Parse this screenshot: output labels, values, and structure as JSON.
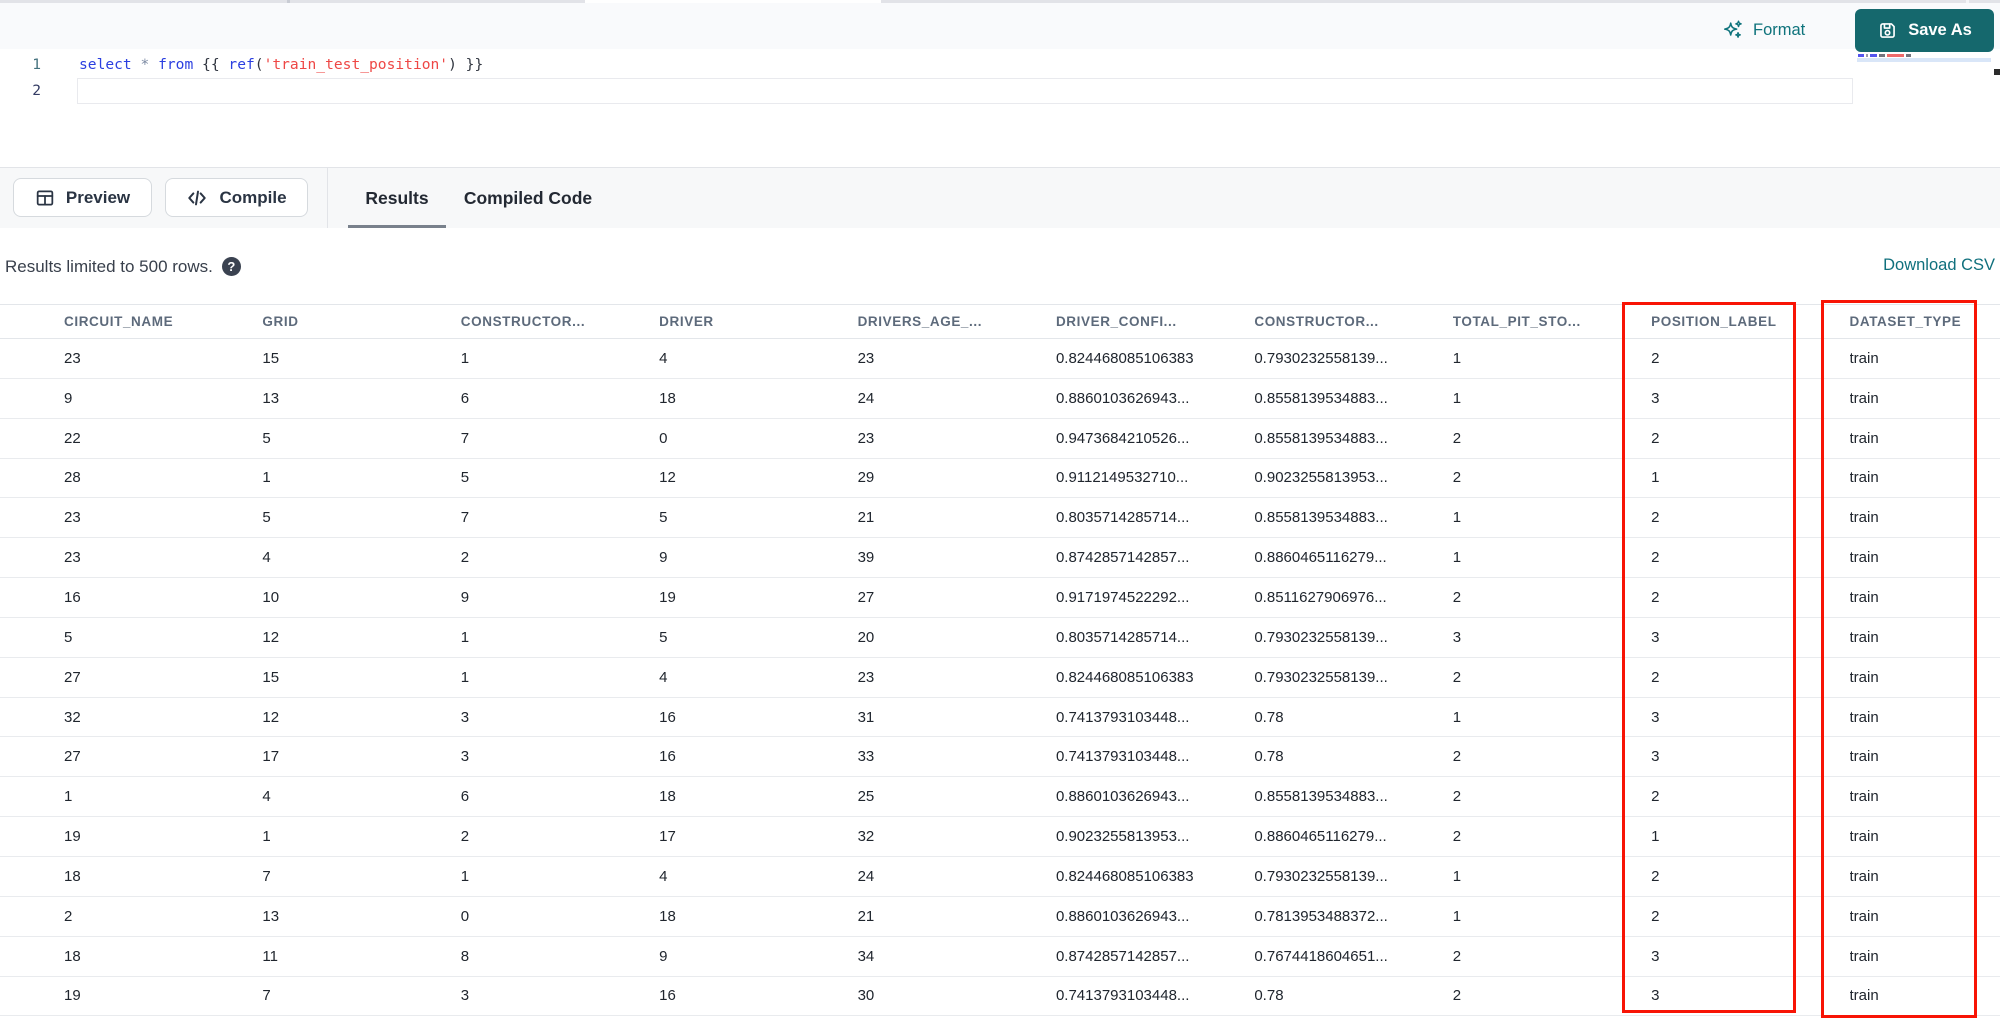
{
  "editor": {
    "line_numbers": [
      "1",
      "2"
    ],
    "code_text": "select * from {{ ref('train_test_position') }}",
    "code_tokens": [
      {
        "text": "select",
        "type": "keyword"
      },
      {
        "text": " ",
        "type": "punct"
      },
      {
        "text": "*",
        "type": "operator"
      },
      {
        "text": " ",
        "type": "punct"
      },
      {
        "text": "from",
        "type": "keyword"
      },
      {
        "text": " {{ ",
        "type": "punct"
      },
      {
        "text": "ref",
        "type": "keyword"
      },
      {
        "text": "(",
        "type": "punct"
      },
      {
        "text": "'train_test_position'",
        "type": "string"
      },
      {
        "text": ")",
        "type": "punct"
      },
      {
        "text": " }}",
        "type": "punct"
      }
    ],
    "actions": {
      "format_label": "Format",
      "save_as_label": "Save As"
    },
    "minimap_segments": [
      {
        "width": 6,
        "color": "#5555ee"
      },
      {
        "width": 2,
        "color": "#9a9aa8"
      },
      {
        "width": 7,
        "color": "#5555ee"
      },
      {
        "width": 6,
        "color": "#74747e"
      },
      {
        "width": 17,
        "color": "#ee6a6a"
      },
      {
        "width": 5,
        "color": "#74747e"
      }
    ]
  },
  "toolbar": {
    "preview_label": "Preview",
    "compile_label": "Compile"
  },
  "result_tabs": {
    "results_label": "Results",
    "compiled_label": "Compiled Code"
  },
  "results": {
    "limit_note": "Results limited to 500 rows.",
    "help_glyph": "?",
    "download_csv_label": "Download CSV"
  },
  "table": {
    "columns": [
      "CIRCUIT_NAME",
      "GRID",
      "CONSTRUCTOR...",
      "DRIVER",
      "DRIVERS_AGE_...",
      "DRIVER_CONFI...",
      "CONSTRUCTOR...",
      "TOTAL_PIT_STO...",
      "POSITION_LABEL",
      "DATASET_TYPE"
    ],
    "rows": [
      [
        "23",
        "15",
        "1",
        "4",
        "23",
        "0.824468085106383",
        "0.7930232558139...",
        "1",
        "2",
        "train"
      ],
      [
        "9",
        "13",
        "6",
        "18",
        "24",
        "0.8860103626943...",
        "0.8558139534883...",
        "1",
        "3",
        "train"
      ],
      [
        "22",
        "5",
        "7",
        "0",
        "23",
        "0.9473684210526...",
        "0.8558139534883...",
        "2",
        "2",
        "train"
      ],
      [
        "28",
        "1",
        "5",
        "12",
        "29",
        "0.9112149532710...",
        "0.9023255813953...",
        "2",
        "1",
        "train"
      ],
      [
        "23",
        "5",
        "7",
        "5",
        "21",
        "0.8035714285714...",
        "0.8558139534883...",
        "1",
        "2",
        "train"
      ],
      [
        "23",
        "4",
        "2",
        "9",
        "39",
        "0.8742857142857...",
        "0.8860465116279...",
        "1",
        "2",
        "train"
      ],
      [
        "16",
        "10",
        "9",
        "19",
        "27",
        "0.9171974522292...",
        "0.8511627906976...",
        "2",
        "2",
        "train"
      ],
      [
        "5",
        "12",
        "1",
        "5",
        "20",
        "0.8035714285714...",
        "0.7930232558139...",
        "3",
        "3",
        "train"
      ],
      [
        "27",
        "15",
        "1",
        "4",
        "23",
        "0.824468085106383",
        "0.7930232558139...",
        "2",
        "2",
        "train"
      ],
      [
        "32",
        "12",
        "3",
        "16",
        "31",
        "0.7413793103448...",
        "0.78",
        "1",
        "3",
        "train"
      ],
      [
        "27",
        "17",
        "3",
        "16",
        "33",
        "0.7413793103448...",
        "0.78",
        "2",
        "3",
        "train"
      ],
      [
        "1",
        "4",
        "6",
        "18",
        "25",
        "0.8860103626943...",
        "0.8558139534883...",
        "2",
        "2",
        "train"
      ],
      [
        "19",
        "1",
        "2",
        "17",
        "32",
        "0.9023255813953...",
        "0.8860465116279...",
        "2",
        "1",
        "train"
      ],
      [
        "18",
        "7",
        "1",
        "4",
        "24",
        "0.824468085106383",
        "0.7930232558139...",
        "1",
        "2",
        "train"
      ],
      [
        "2",
        "13",
        "0",
        "18",
        "21",
        "0.8860103626943...",
        "0.7813953488372...",
        "1",
        "2",
        "train"
      ],
      [
        "18",
        "11",
        "8",
        "9",
        "34",
        "0.8742857142857...",
        "0.7674418604651...",
        "2",
        "3",
        "train"
      ],
      [
        "19",
        "7",
        "3",
        "16",
        "30",
        "0.7413793103448...",
        "0.78",
        "2",
        "3",
        "train"
      ]
    ]
  },
  "annotations": {
    "highlight_color": "#f81405",
    "highlighted_columns": [
      "POSITION_LABEL",
      "DATASET_TYPE"
    ]
  },
  "colors": {
    "accent_teal": "#15686d",
    "keyword_blue": "#2b3fe0",
    "string_red": "#ee4745",
    "header_text": "#5d6a7b",
    "cell_text": "#20262e"
  }
}
